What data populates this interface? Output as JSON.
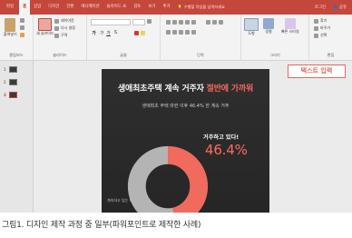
{
  "ribbon": {
    "tabs": [
      "파일",
      "홈",
      "삽입",
      "디자인",
      "전환",
      "애니메이션",
      "슬라이드 쇼",
      "검토",
      "보기",
      "추가"
    ],
    "active_tab_index": 1,
    "tell_me": "수행할 작업을 입력하세요",
    "sign_in": "로그인",
    "share": "공유",
    "groups": {
      "clipboard": {
        "label": "클립보드",
        "paste": "붙여넣기"
      },
      "slides": {
        "label": "슬라이드",
        "new_slide": "새 슬라이드",
        "layout": "레이아웃",
        "reset": "다시 설정",
        "section": "구역"
      },
      "font": {
        "label": "글꼴",
        "bold": "가",
        "italic": "가",
        "underline": "가",
        "shadow": "S"
      },
      "paragraph": {
        "label": "단락"
      },
      "drawing": {
        "label": "그리기",
        "shapes": "도형",
        "arrange": "정렬",
        "quick_styles": "빠른 스타일"
      },
      "editing": {
        "label": "편집",
        "find": "찾기",
        "replace": "바꾸기",
        "select": "선택"
      }
    }
  },
  "thumbnails": {
    "numbers": [
      "1",
      "2",
      "3"
    ],
    "selected_index": 2
  },
  "slide": {
    "title_main": "생애최초주택 계속 거주자 ",
    "title_highlight": "절반에 가까워",
    "subtitle": "생애최초 주택 마련 이후 46.4% 한 계속 거주",
    "callout": "거주하고 있다!",
    "percent": "46.4%",
    "note": "계속하고 있는 다",
    "colors": {
      "background": "#2b2b2b",
      "highlight": "#f26a5e",
      "donut_gray": "#b4b4b4",
      "donut_red": "#f06a5e"
    }
  },
  "chart_data": {
    "type": "pie",
    "values": [
      46.4,
      53.6
    ],
    "colors": [
      "#f06a5e",
      "#b4b4b4"
    ]
  },
  "annotation_label": "텍스트 입력",
  "caption": "그림1. 디자인 제작 과정 중 일부(파워포인트로 제작한 사례)"
}
